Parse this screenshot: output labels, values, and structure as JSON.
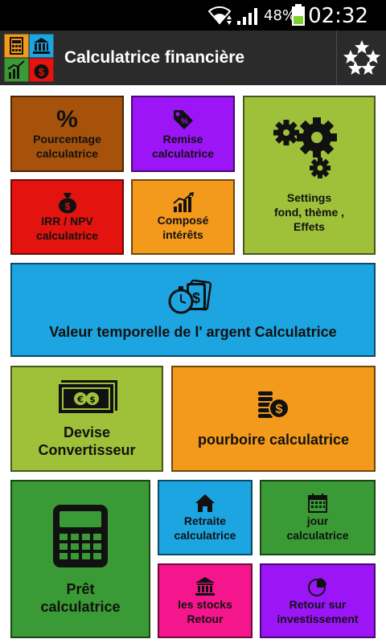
{
  "status": {
    "battery_pct": "48%",
    "time": "02:32"
  },
  "app": {
    "title": "Calculatrice financière"
  },
  "tiles": {
    "percentage": {
      "symbol": "%",
      "label": "Pourcentage\ncalculatrice",
      "color": "#a6520b"
    },
    "discount": {
      "label": "Remise\ncalculatrice",
      "color": "#9b15f7"
    },
    "settings": {
      "label": "Settings\nfond, thème ,\nEffets",
      "color": "#9fc13a"
    },
    "irr_npv": {
      "label": "IRR / NPV\ncalculatrice",
      "color": "#e3140f"
    },
    "compound": {
      "label": "Composé\nintérêts",
      "color": "#f39a1c"
    },
    "time_value": {
      "label": "Valeur temporelle de l' argent Calculatrice",
      "color": "#1ca5e0"
    },
    "currency": {
      "label": "Devise\nConvertisseur",
      "color": "#9fc13a"
    },
    "tip": {
      "label": "pourboire calculatrice",
      "color": "#f39a1c"
    },
    "loan": {
      "label": "Prêt\ncalculatrice",
      "color": "#3a9a35"
    },
    "retirement": {
      "label": "Retraite\ncalculatrice",
      "color": "#1ca5e0"
    },
    "day": {
      "label": "jour\ncalculatrice",
      "color": "#3a9a35"
    },
    "stocks": {
      "label": "les stocks\nRetour",
      "color": "#f5158c"
    },
    "roi": {
      "label": "Retour sur\ninvestissement",
      "color": "#9b15f7"
    }
  }
}
